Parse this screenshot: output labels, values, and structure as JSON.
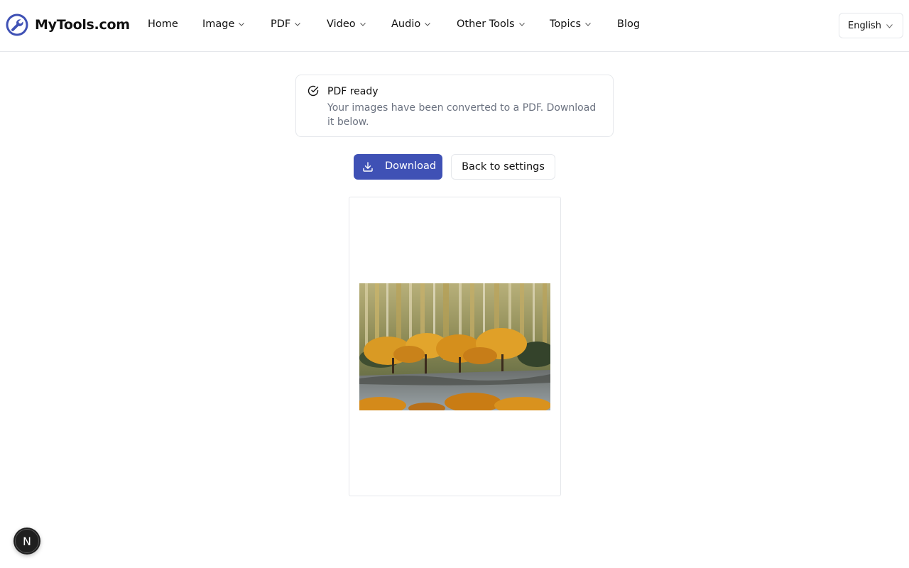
{
  "brand": {
    "name": "MyTools.com",
    "accent": "#3f51b5"
  },
  "nav": {
    "items": [
      {
        "label": "Home",
        "dropdown": false
      },
      {
        "label": "Image",
        "dropdown": true
      },
      {
        "label": "PDF",
        "dropdown": true
      },
      {
        "label": "Video",
        "dropdown": true
      },
      {
        "label": "Audio",
        "dropdown": true
      },
      {
        "label": "Other Tools",
        "dropdown": true
      },
      {
        "label": "Topics",
        "dropdown": true
      },
      {
        "label": "Blog",
        "dropdown": false
      }
    ]
  },
  "language": {
    "selected": "English"
  },
  "alert": {
    "icon": "check-circle-icon",
    "title": "PDF ready",
    "description": "Your images have been converted to a PDF. Download it below."
  },
  "actions": {
    "download_label": "Download",
    "back_label": "Back to settings"
  },
  "preview": {
    "image": "autumn-trees-photo"
  },
  "badge": {
    "letter": "N"
  }
}
